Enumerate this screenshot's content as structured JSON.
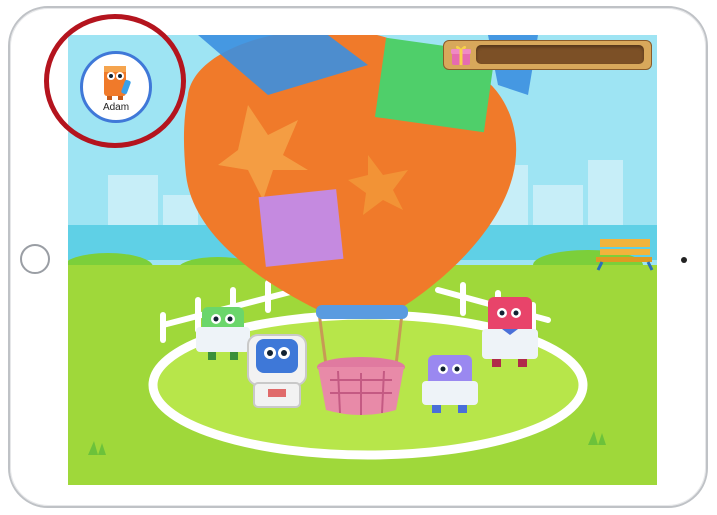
{
  "profile": {
    "name": "Adam",
    "avatar": "orange-monster-avatar-icon"
  },
  "reward": {
    "icon": "gift-box-icon",
    "progress": 0.0
  },
  "scene": {
    "description_icons": [
      "hot-air-balloon-icon",
      "park-bench-icon",
      "fence-icon"
    ],
    "characters": [
      "green-frog-character",
      "astronaut-character",
      "purple-character",
      "red-scientist-character"
    ]
  },
  "colors": {
    "accent": "#3f78d8",
    "highlight_ring": "#b4141e",
    "grass": "#9fd83a",
    "balloon": "#f07a2a"
  }
}
